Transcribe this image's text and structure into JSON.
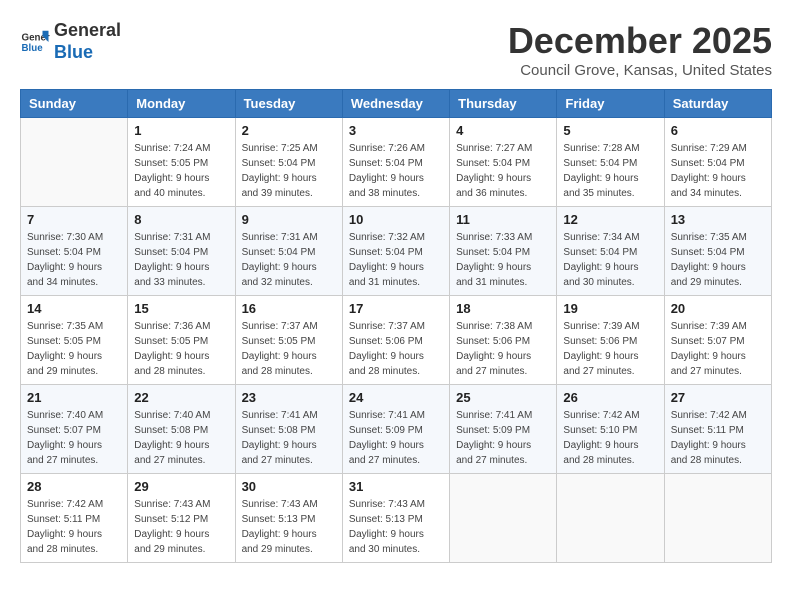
{
  "logo": {
    "line1": "General",
    "line2": "Blue"
  },
  "title": "December 2025",
  "location": "Council Grove, Kansas, United States",
  "weekdays": [
    "Sunday",
    "Monday",
    "Tuesday",
    "Wednesday",
    "Thursday",
    "Friday",
    "Saturday"
  ],
  "weeks": [
    [
      {
        "day": "",
        "detail": ""
      },
      {
        "day": "1",
        "detail": "Sunrise: 7:24 AM\nSunset: 5:05 PM\nDaylight: 9 hours\nand 40 minutes."
      },
      {
        "day": "2",
        "detail": "Sunrise: 7:25 AM\nSunset: 5:04 PM\nDaylight: 9 hours\nand 39 minutes."
      },
      {
        "day": "3",
        "detail": "Sunrise: 7:26 AM\nSunset: 5:04 PM\nDaylight: 9 hours\nand 38 minutes."
      },
      {
        "day": "4",
        "detail": "Sunrise: 7:27 AM\nSunset: 5:04 PM\nDaylight: 9 hours\nand 36 minutes."
      },
      {
        "day": "5",
        "detail": "Sunrise: 7:28 AM\nSunset: 5:04 PM\nDaylight: 9 hours\nand 35 minutes."
      },
      {
        "day": "6",
        "detail": "Sunrise: 7:29 AM\nSunset: 5:04 PM\nDaylight: 9 hours\nand 34 minutes."
      }
    ],
    [
      {
        "day": "7",
        "detail": "Sunrise: 7:30 AM\nSunset: 5:04 PM\nDaylight: 9 hours\nand 34 minutes."
      },
      {
        "day": "8",
        "detail": "Sunrise: 7:31 AM\nSunset: 5:04 PM\nDaylight: 9 hours\nand 33 minutes."
      },
      {
        "day": "9",
        "detail": "Sunrise: 7:31 AM\nSunset: 5:04 PM\nDaylight: 9 hours\nand 32 minutes."
      },
      {
        "day": "10",
        "detail": "Sunrise: 7:32 AM\nSunset: 5:04 PM\nDaylight: 9 hours\nand 31 minutes."
      },
      {
        "day": "11",
        "detail": "Sunrise: 7:33 AM\nSunset: 5:04 PM\nDaylight: 9 hours\nand 31 minutes."
      },
      {
        "day": "12",
        "detail": "Sunrise: 7:34 AM\nSunset: 5:04 PM\nDaylight: 9 hours\nand 30 minutes."
      },
      {
        "day": "13",
        "detail": "Sunrise: 7:35 AM\nSunset: 5:04 PM\nDaylight: 9 hours\nand 29 minutes."
      }
    ],
    [
      {
        "day": "14",
        "detail": "Sunrise: 7:35 AM\nSunset: 5:05 PM\nDaylight: 9 hours\nand 29 minutes."
      },
      {
        "day": "15",
        "detail": "Sunrise: 7:36 AM\nSunset: 5:05 PM\nDaylight: 9 hours\nand 28 minutes."
      },
      {
        "day": "16",
        "detail": "Sunrise: 7:37 AM\nSunset: 5:05 PM\nDaylight: 9 hours\nand 28 minutes."
      },
      {
        "day": "17",
        "detail": "Sunrise: 7:37 AM\nSunset: 5:06 PM\nDaylight: 9 hours\nand 28 minutes."
      },
      {
        "day": "18",
        "detail": "Sunrise: 7:38 AM\nSunset: 5:06 PM\nDaylight: 9 hours\nand 27 minutes."
      },
      {
        "day": "19",
        "detail": "Sunrise: 7:39 AM\nSunset: 5:06 PM\nDaylight: 9 hours\nand 27 minutes."
      },
      {
        "day": "20",
        "detail": "Sunrise: 7:39 AM\nSunset: 5:07 PM\nDaylight: 9 hours\nand 27 minutes."
      }
    ],
    [
      {
        "day": "21",
        "detail": "Sunrise: 7:40 AM\nSunset: 5:07 PM\nDaylight: 9 hours\nand 27 minutes."
      },
      {
        "day": "22",
        "detail": "Sunrise: 7:40 AM\nSunset: 5:08 PM\nDaylight: 9 hours\nand 27 minutes."
      },
      {
        "day": "23",
        "detail": "Sunrise: 7:41 AM\nSunset: 5:08 PM\nDaylight: 9 hours\nand 27 minutes."
      },
      {
        "day": "24",
        "detail": "Sunrise: 7:41 AM\nSunset: 5:09 PM\nDaylight: 9 hours\nand 27 minutes."
      },
      {
        "day": "25",
        "detail": "Sunrise: 7:41 AM\nSunset: 5:09 PM\nDaylight: 9 hours\nand 27 minutes."
      },
      {
        "day": "26",
        "detail": "Sunrise: 7:42 AM\nSunset: 5:10 PM\nDaylight: 9 hours\nand 28 minutes."
      },
      {
        "day": "27",
        "detail": "Sunrise: 7:42 AM\nSunset: 5:11 PM\nDaylight: 9 hours\nand 28 minutes."
      }
    ],
    [
      {
        "day": "28",
        "detail": "Sunrise: 7:42 AM\nSunset: 5:11 PM\nDaylight: 9 hours\nand 28 minutes."
      },
      {
        "day": "29",
        "detail": "Sunrise: 7:43 AM\nSunset: 5:12 PM\nDaylight: 9 hours\nand 29 minutes."
      },
      {
        "day": "30",
        "detail": "Sunrise: 7:43 AM\nSunset: 5:13 PM\nDaylight: 9 hours\nand 29 minutes."
      },
      {
        "day": "31",
        "detail": "Sunrise: 7:43 AM\nSunset: 5:13 PM\nDaylight: 9 hours\nand 30 minutes."
      },
      {
        "day": "",
        "detail": ""
      },
      {
        "day": "",
        "detail": ""
      },
      {
        "day": "",
        "detail": ""
      }
    ]
  ]
}
